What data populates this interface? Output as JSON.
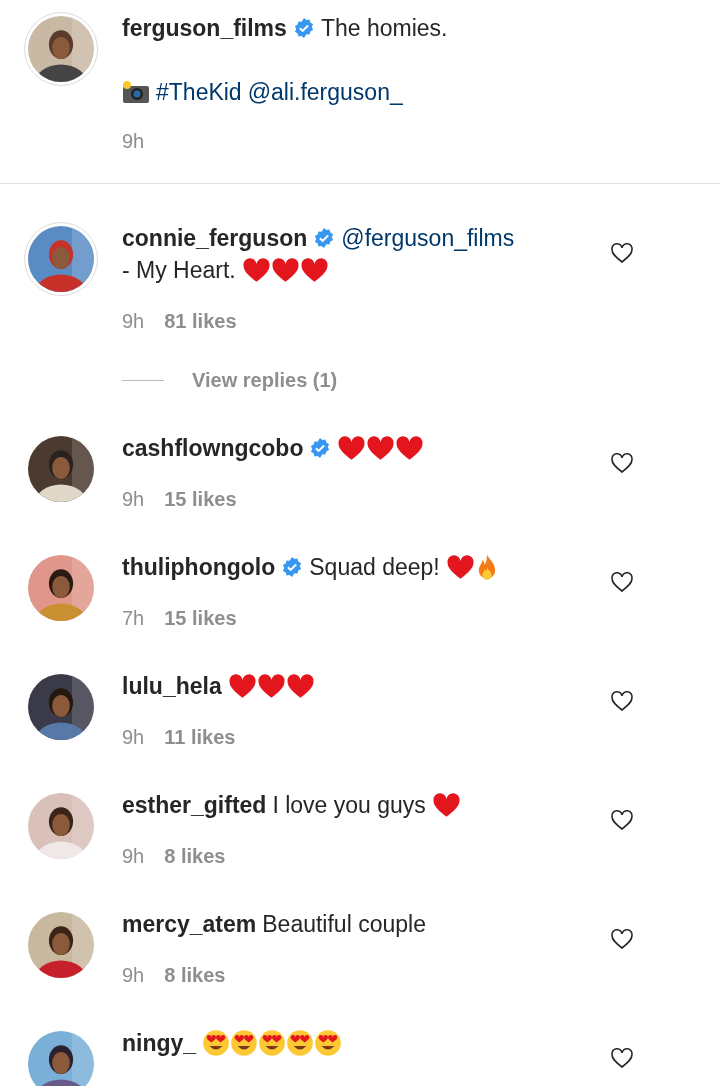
{
  "caption": {
    "username": "ferguson_films",
    "verified": true,
    "text": "The homies.",
    "line2": [
      {
        "kind": "camera"
      },
      {
        "kind": "link",
        "text": "#TheKid"
      },
      {
        "kind": "link",
        "text": "@ali.ferguson_"
      }
    ],
    "time": "9h"
  },
  "comments": [
    {
      "username": "connie_ferguson",
      "verified": true,
      "parts": [
        {
          "kind": "link",
          "text": "@ferguson_films"
        },
        {
          "kind": "text",
          "text": "- My Heart."
        },
        {
          "kind": "heart"
        },
        {
          "kind": "heart"
        },
        {
          "kind": "heart"
        }
      ],
      "time": "9h",
      "likes": "81 likes",
      "liked": false,
      "replies": "View replies (1)"
    },
    {
      "username": "cashflowngcobo",
      "verified": true,
      "parts": [
        {
          "kind": "heart"
        },
        {
          "kind": "heart"
        },
        {
          "kind": "heart"
        }
      ],
      "time": "9h",
      "likes": "15 likes",
      "liked": false
    },
    {
      "username": "thuliphongolo",
      "verified": true,
      "parts": [
        {
          "kind": "text",
          "text": "Squad deep!"
        },
        {
          "kind": "heart"
        },
        {
          "kind": "fire"
        }
      ],
      "time": "7h",
      "likes": "15 likes",
      "liked": false
    },
    {
      "username": "lulu_hela",
      "verified": false,
      "parts": [
        {
          "kind": "heart"
        },
        {
          "kind": "heart"
        },
        {
          "kind": "heart"
        }
      ],
      "time": "9h",
      "likes": "11 likes",
      "liked": false
    },
    {
      "username": "esther_gifted",
      "verified": false,
      "parts": [
        {
          "kind": "text",
          "text": "I love you guys"
        },
        {
          "kind": "heart"
        }
      ],
      "time": "9h",
      "likes": "8 likes",
      "liked": false
    },
    {
      "username": "mercy_atem",
      "verified": false,
      "parts": [
        {
          "kind": "text",
          "text": "Beautiful couple"
        }
      ],
      "time": "9h",
      "likes": "8 likes",
      "liked": false
    },
    {
      "username": "ningy_",
      "verified": false,
      "parts": [
        {
          "kind": "smiley"
        },
        {
          "kind": "smiley"
        },
        {
          "kind": "smiley"
        },
        {
          "kind": "smiley"
        },
        {
          "kind": "smiley"
        }
      ],
      "liked": false
    }
  ]
}
